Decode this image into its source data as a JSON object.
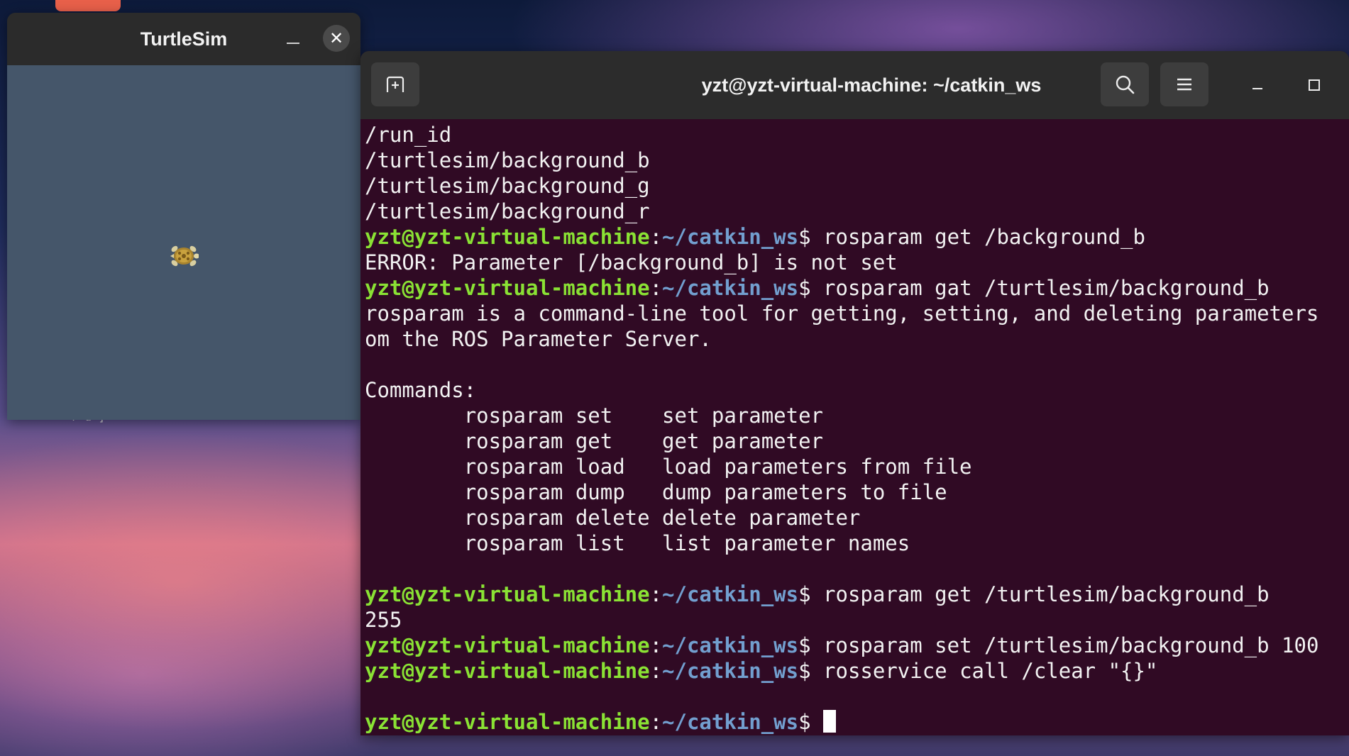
{
  "desktop": {
    "label_fragment": "r u ]",
    "colors": {
      "dock_accent": "#e8604a"
    }
  },
  "turtlesim": {
    "title": "TurtleSim",
    "minimize_icon": "minimize-icon",
    "close_icon": "close-icon",
    "close_glyph": "✕",
    "canvas_color": "#45566a"
  },
  "terminal": {
    "title": "yzt@yzt-virtual-machine: ~/catkin_ws",
    "icons": [
      "new-tab-icon",
      "search-icon",
      "hamburger-menu-icon",
      "minimize-icon",
      "maximize-icon"
    ],
    "colors": {
      "background": "#300a24",
      "user": "#8ae234",
      "path": "#729fcf",
      "text": "#f2f2f2"
    },
    "prompt": {
      "user_host": "yzt@yzt-virtual-machine",
      "colon": ":",
      "path": "~/catkin_ws",
      "dollar": "$ "
    },
    "lines": [
      {
        "text": "/run_id"
      },
      {
        "text": "/turtlesim/background_b"
      },
      {
        "text": "/turtlesim/background_g"
      },
      {
        "text": "/turtlesim/background_r"
      },
      {
        "prompt": true,
        "cmd": "rosparam get /background_b"
      },
      {
        "text": "ERROR: Parameter [/background_b] is not set"
      },
      {
        "prompt": true,
        "cmd": "rosparam gat /turtlesim/background_b"
      },
      {
        "text": "rosparam is a command-line tool for getting, setting, and deleting parameters"
      },
      {
        "text": "om the ROS Parameter Server."
      },
      {
        "text": ""
      },
      {
        "text": "Commands:"
      },
      {
        "text": "\trosparam set\tset parameter"
      },
      {
        "text": "\trosparam get\tget parameter"
      },
      {
        "text": "\trosparam load\tload parameters from file"
      },
      {
        "text": "\trosparam dump\tdump parameters to file"
      },
      {
        "text": "\trosparam delete\tdelete parameter"
      },
      {
        "text": "\trosparam list\tlist parameter names"
      },
      {
        "text": ""
      },
      {
        "prompt": true,
        "cmd": "rosparam get /turtlesim/background_b"
      },
      {
        "text": "255"
      },
      {
        "prompt": true,
        "cmd": "rosparam set /turtlesim/background_b 100"
      },
      {
        "prompt": true,
        "cmd": "rosservice call /clear \"{}\""
      },
      {
        "text": ""
      },
      {
        "prompt": true,
        "cmd": "",
        "cursor": true
      }
    ]
  }
}
